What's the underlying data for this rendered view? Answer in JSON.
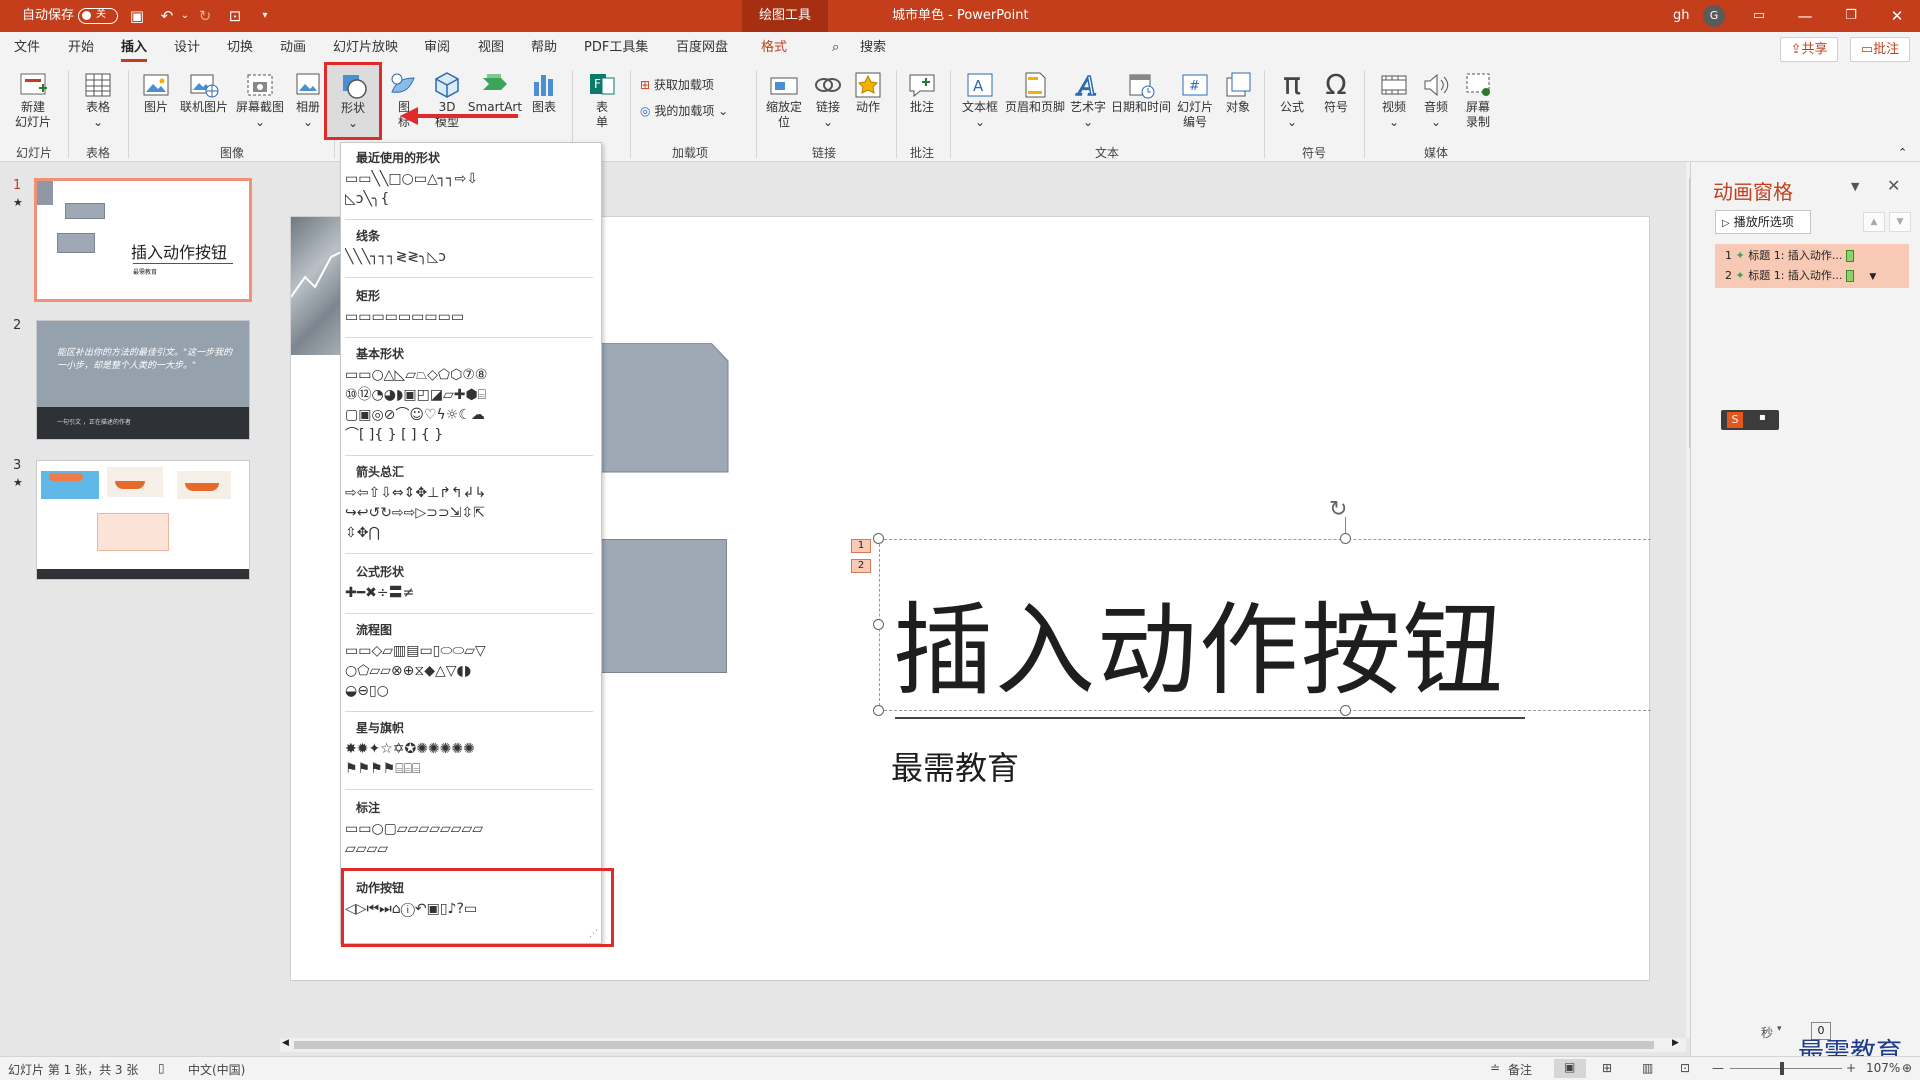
{
  "titlebar": {
    "autosave_label": "自动保存",
    "autosave_state": "关",
    "context_tab": "绘图工具",
    "doc_title": "城市单色  -  PowerPoint",
    "user": "gh",
    "avatar_letter": "G"
  },
  "tabs": [
    "文件",
    "开始",
    "插入",
    "设计",
    "切换",
    "动画",
    "幻灯片放映",
    "审阅",
    "视图",
    "帮助",
    "PDF工具集",
    "百度网盘",
    "格式"
  ],
  "active_tab": "插入",
  "search_label": "搜索",
  "share_label": "共享",
  "comment_label": "批注",
  "ribbon": {
    "new_slide": "新建",
    "new_slide2": "幻灯片",
    "table": "表格",
    "picture": "图片",
    "online_picture": "联机图片",
    "screenshot": "屏幕截图",
    "album": "相册",
    "shapes": "形状",
    "icons1": "图",
    "icons2": "标",
    "model3d_1": "3D",
    "model3d_2": "模型",
    "smartart": "SmartArt",
    "chart": "图表",
    "form1": "表",
    "form2": "单",
    "get_addins": "获取加载项",
    "my_addins": "我的加载项",
    "zoom1": "缩放定",
    "zoom2": "位",
    "link": "链接",
    "action": "动作",
    "comment": "批注",
    "textbox": "文本框",
    "header_footer": "页眉和页脚",
    "wordart": "艺术字",
    "datetime": "日期和时间",
    "slide_number1": "幻灯片",
    "slide_number2": "编号",
    "object": "对象",
    "equation": "公式",
    "symbol": "符号",
    "video": "视频",
    "audio": "音频",
    "screen_rec1": "屏幕",
    "screen_rec2": "录制",
    "groups": {
      "slides": "幻灯片",
      "tables": "表格",
      "images": "图像",
      "addins": "加载项",
      "links": "链接",
      "comments": "批注",
      "text": "文本",
      "symbols": "符号",
      "media": "媒体"
    }
  },
  "gallery": {
    "sections": [
      {
        "title": "最近使用的形状",
        "rows": [
          "▭▭╲╲□○▭△┐┐⇨⇩",
          "◺ↄ╲╮{"
        ]
      },
      {
        "title": "线条",
        "rows": [
          "╲╲╲┐┐┐≷≷╮◺ↄ"
        ]
      },
      {
        "title": "矩形",
        "rows": [
          "▭▭▭▭▭▭▭▭▭"
        ]
      },
      {
        "title": "基本形状",
        "rows": [
          "▭▭○△◺▱⏢◇⬠⬡⑦⑧",
          "⑩⑫◔◕◗▣◰◪▱✚⬢⌸",
          "▢▣◎⊘⌒☺♡ϟ☼☾☁",
          "⌒[ ]{ } [ ] { }"
        ]
      },
      {
        "title": "箭头总汇",
        "rows": [
          "⇨⇦⇧⇩⇔⇕✥⊥↱↰↲↳",
          "↪↩↺↻⇨⇨▷⊃⊃⇲⇳⇱",
          "⇳✥⋂"
        ]
      },
      {
        "title": "公式形状",
        "rows": [
          "✚━✖÷〓≠"
        ]
      },
      {
        "title": "流程图",
        "rows": [
          "▭▭◇▱▥▤▭▯⬭⬭▱▽",
          "○⬠▱▱⊗⊕⧖◆△▽◖◗",
          "◒⊖▯○"
        ]
      },
      {
        "title": "星与旗帜",
        "rows": [
          "✸✹✦☆✡✪✺✺✺✺✺",
          "⚑⚑⚑⚑⌸⌸⌸"
        ]
      },
      {
        "title": "标注",
        "rows": [
          "▭▭○▢▱▱▱▱▱▱▱▱",
          "▱▱▱▱"
        ]
      },
      {
        "title": "动作按钮",
        "rows": [
          "◁▷⏮⏭⌂ⓘ↶▣▯♪?▭"
        ]
      }
    ]
  },
  "slides_pane": {
    "thumbs": [
      {
        "num": "1",
        "title": "插入动作按钮",
        "subtitle": "最需教育",
        "star": "★"
      },
      {
        "num": "2",
        "quote": "能区补出你的方法的最佳引文。\"这一步我的一小步，却是整个人类的一大步。\"",
        "author": "一句引文 ，正在描述的作者"
      },
      {
        "num": "3",
        "star": "★"
      }
    ]
  },
  "slide": {
    "title": "插入动作按钮",
    "subtitle": "最需教育",
    "anim_tag1": "1",
    "anim_tag2": "2"
  },
  "anim_pane": {
    "title": "动画窗格",
    "play_label": "播放所选项",
    "items": [
      {
        "num": "1",
        "label": "标题 1: 插入动作..."
      },
      {
        "num": "2",
        "label": "标题 1: 插入动作..."
      }
    ],
    "seconds": "秒",
    "timeline": "0"
  },
  "status": {
    "slide_info": "幻灯片 第 1 张，共 3 张",
    "language": "中文(中国)",
    "notes": "备注",
    "zoom": "107%"
  },
  "watermark": "最需教育",
  "colors": {
    "brand": "#c43e1c",
    "highlight": "#e02b2b",
    "anim_item": "#f8c9b4",
    "shape_fill": "#9ea9b5"
  }
}
